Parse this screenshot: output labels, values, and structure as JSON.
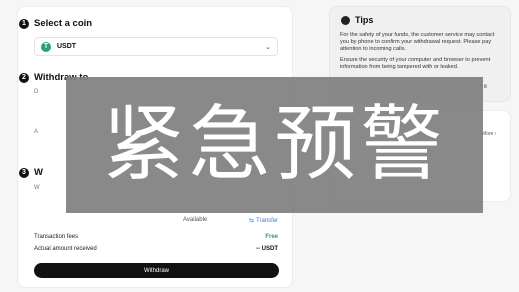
{
  "steps": {
    "s1": {
      "num": "1",
      "title": "Select a coin"
    },
    "s2": {
      "num": "2",
      "title": "Withdraw to"
    },
    "s3": {
      "num": "3",
      "title": "W"
    }
  },
  "coin": {
    "icon_name": "usdt-icon",
    "icon_glyph": "T",
    "label": "USDT"
  },
  "fragments": {
    "f1": "D",
    "f2": "A",
    "f3": "W"
  },
  "available": {
    "label": "Available",
    "transfer_label": "Transfer"
  },
  "fees": {
    "label": "Transaction fees",
    "value": "Free"
  },
  "received": {
    "label": "Actual amount received",
    "value": "-- USDT"
  },
  "withdraw_button": "Withdraw",
  "tips": {
    "title": "Tips",
    "p1": "For the safety of your funds, the customer service may contact you by phone to confirm your withdrawal request. Please pay attention to incoming calls.",
    "p2": "Ensure the security of your computer and browser to prevent information from being tampered with or leaked.",
    "p3_fragment": "ll it"
  },
  "more_label": "More",
  "banner_text": "紧急预警",
  "colors": {
    "accent": "#2f7de1",
    "free": "#27a05a",
    "usdt": "#26a17b",
    "button": "#111111"
  }
}
